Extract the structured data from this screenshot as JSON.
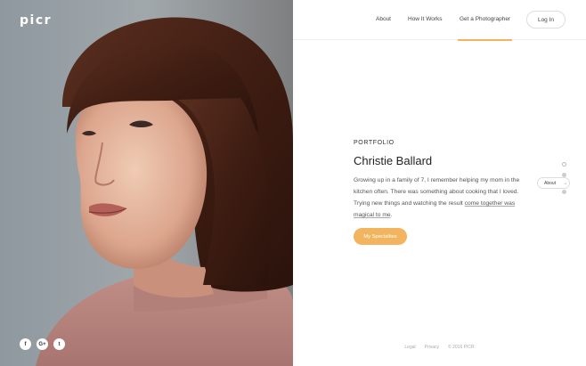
{
  "brand": {
    "logo": "picr"
  },
  "nav": {
    "items": [
      {
        "label": "About"
      },
      {
        "label": "How It Works"
      },
      {
        "label": "Get a Photographer"
      }
    ],
    "login_label": "Log In"
  },
  "hero": {
    "eyebrow": "PORTFOLIO",
    "name": "Christie Ballard",
    "bio_part1": "Growing up in a family of 7, I remember helping my mom in the kitchen often. There was something about cooking that I loved. Trying new things and watching the result ",
    "bio_link": "come together was magical to me",
    "bio_end": ".",
    "cta_label": "My Specialties"
  },
  "section_nav": {
    "active_label": "About",
    "arrow": "→"
  },
  "social": {
    "facebook": "f",
    "google": "G+",
    "twitter": "t"
  },
  "footer": {
    "legal": "Legal",
    "privacy": "Privacy",
    "copyright": "© 2016 PICR"
  },
  "colors": {
    "accent": "#f2b45e"
  },
  "icons": [
    "facebook-icon",
    "google-plus-icon",
    "twitter-icon",
    "arrow-right-icon"
  ]
}
